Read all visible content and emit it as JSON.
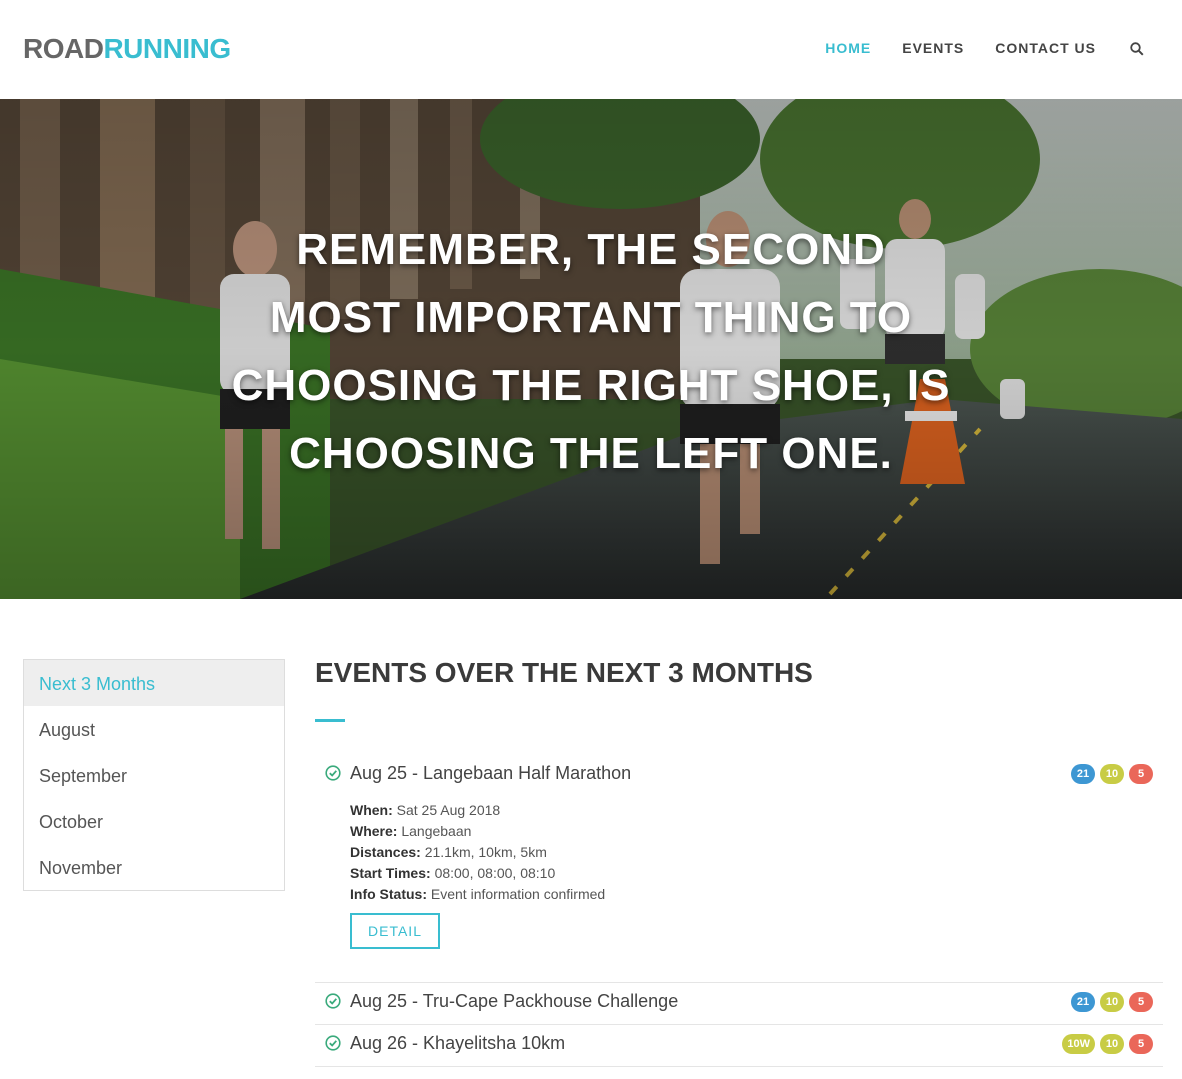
{
  "header": {
    "logo_part1": "ROAD",
    "logo_part2": "RUNNING",
    "nav": [
      {
        "label": "HOME",
        "active": true
      },
      {
        "label": "EVENTS",
        "active": false
      },
      {
        "label": "CONTACT US",
        "active": false
      }
    ],
    "search_icon": "search-icon"
  },
  "hero": {
    "quote": "REMEMBER, THE SECOND MOST IMPORTANT THING TO CHOOSING THE RIGHT SHOE, IS CHOOSING THE LEFT ONE."
  },
  "sidebar": {
    "items": [
      {
        "label": "Next 3 Months",
        "active": true
      },
      {
        "label": "August",
        "active": false
      },
      {
        "label": "September",
        "active": false
      },
      {
        "label": "October",
        "active": false
      },
      {
        "label": "November",
        "active": false
      }
    ]
  },
  "main": {
    "title": "EVENTS OVER THE NEXT 3 MONTHS",
    "events": [
      {
        "title": "Aug 25 - Langebaan Half Marathon",
        "badges": [
          "21",
          "10",
          "5"
        ],
        "when_label": "When:",
        "when": "Sat 25 Aug 2018",
        "where_label": "Where:",
        "where": "Langebaan",
        "distances_label": "Distances:",
        "distances": "21.1km, 10km, 5km",
        "start_label": "Start Times:",
        "start": "08:00, 08:00, 08:10",
        "status_label": "Info Status:",
        "status": "Event information confirmed",
        "detail_button": "DETAIL"
      },
      {
        "title": "Aug 25 - Tru-Cape Packhouse Challenge",
        "badges": [
          "21",
          "10",
          "5"
        ]
      },
      {
        "title": "Aug 26 - Khayelitsha 10km",
        "badges": [
          "10W",
          "10",
          "5"
        ]
      }
    ]
  },
  "colors": {
    "accent": "#39bdd0",
    "badge_blue": "#3d97d3",
    "badge_yellow": "#c8cc45",
    "badge_red": "#ea6759",
    "check_green": "#3aaa7c"
  }
}
